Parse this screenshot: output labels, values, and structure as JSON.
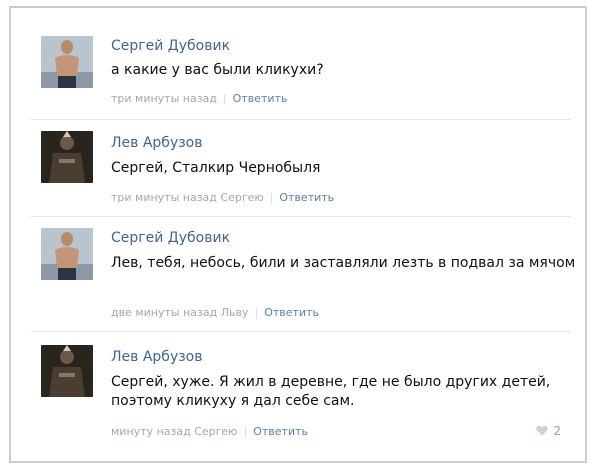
{
  "comments": [
    {
      "author": "Сергей Дубовик",
      "text": "а какие у вас были кликухи?",
      "time": "три минуты назад",
      "reply_to": "",
      "reply_label": "Ответить",
      "avatar": "shirtless-man-photo"
    },
    {
      "author": "Лев Арбузов",
      "text": "Сергей, Сталкир Чернобыля",
      "time": "три минуты назад",
      "reply_to": "Сергею",
      "reply_label": "Ответить",
      "avatar": "stalker-game-character"
    },
    {
      "author": "Сергей Дубовик",
      "text": "Лев, тебя, небось, били и заставляли лезть в подвал за мячом",
      "time": "две минуты назад",
      "reply_to": "Льву",
      "reply_label": "Ответить",
      "avatar": "shirtless-man-photo"
    },
    {
      "author": "Лев Арбузов",
      "text": "Сергей, хуже. Я жил в деревне, где не было других детей, поэтому кликуху я дал себе сам.",
      "time": "минуту назад",
      "reply_to": "Сергею",
      "reply_label": "Ответить",
      "avatar": "stalker-game-character",
      "likes": "2"
    }
  ],
  "colors": {
    "author": "#3f6593",
    "meta": "#a1a8b3",
    "reply": "#5b7fa6",
    "divider": "#e3e7ee"
  }
}
